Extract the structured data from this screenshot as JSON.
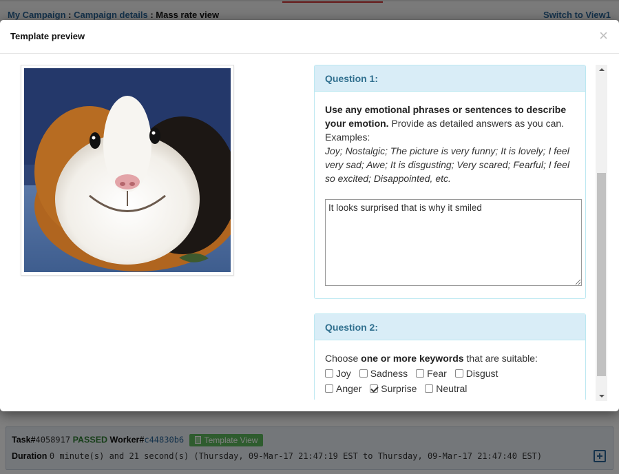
{
  "background": {
    "breadcrumb": {
      "my_campaign": "My Campaign",
      "sep1": " : ",
      "campaign_details": "Campaign details",
      "sep2": " : ",
      "current": "Mass rate view"
    },
    "switch_view": "Switch to View1",
    "task": {
      "task_label": "Task#",
      "task_id": "4058917",
      "status": "PASSED",
      "worker_label": "Worker#",
      "worker_id": "c44830b6",
      "template_view_button": "Template View",
      "duration_label": "Duration",
      "duration_text": "0 minute(s) and 21 second(s) (Thursday, 09-Mar-17 21:47:19 EST to Thursday, 09-Mar-17 21:47:40 EST)"
    }
  },
  "modal": {
    "title": "Template preview",
    "close": "×",
    "image_icon": "guinea-pig-photo",
    "question1": {
      "heading": "Question 1:",
      "instruction_bold": "Use any emotional phrases or sentences to describe your emotion.",
      "instruction_rest": " Provide as detailed answers as you can.",
      "examples_label": "Examples:",
      "examples": "Joy; Nostalgic; The picture is very funny; It is lovely; I feel very sad; Awe; It is disgusting; Very scared; Fearful; I feel so excited; Disappointed, etc.",
      "answer": "It looks surprised that is why it smiled"
    },
    "question2": {
      "heading": "Question 2:",
      "prompt_pre": "Choose ",
      "prompt_bold": "one or more keywords",
      "prompt_post": " that are suitable:",
      "keywords_row1": [
        {
          "label": "Joy",
          "checked": false
        },
        {
          "label": "Sadness",
          "checked": false
        },
        {
          "label": "Fear",
          "checked": false
        },
        {
          "label": "Disgust",
          "checked": false
        }
      ],
      "keywords_row2": [
        {
          "label": "Anger",
          "checked": false
        },
        {
          "label": "Surprise",
          "checked": true
        },
        {
          "label": "Neutral",
          "checked": false
        }
      ]
    }
  },
  "colors": {
    "panel_heading_bg": "#d9edf7",
    "panel_heading_text": "#31708f",
    "link": "#2a6496",
    "passed": "#2e7d32",
    "button_green": "#5cb85c"
  }
}
